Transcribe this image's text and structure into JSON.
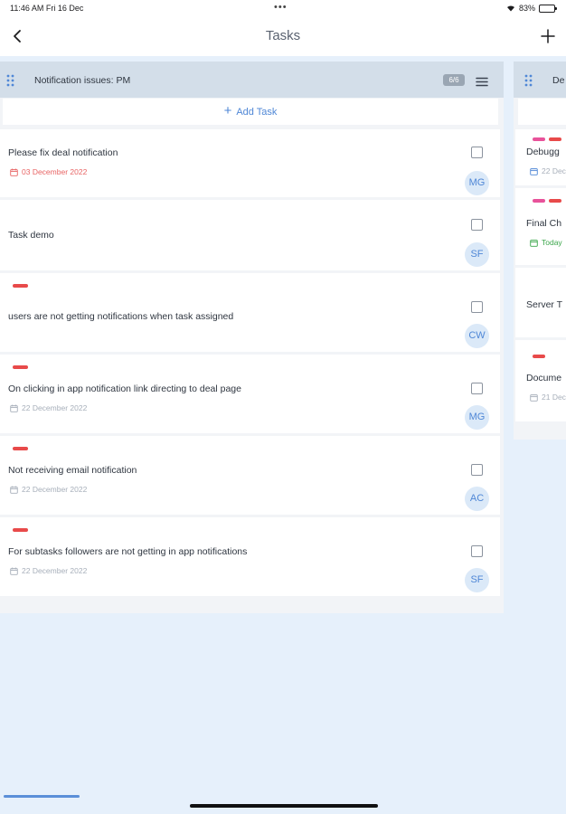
{
  "status_bar": {
    "time": "11:46 AM  Fri 16 Dec",
    "dots": "•••",
    "battery": "83%",
    "battery_level": 0.83
  },
  "nav": {
    "title": "Tasks",
    "back_icon": "chevron-left-icon",
    "add_icon": "plus-icon"
  },
  "column": {
    "title": "Notification issues: PM",
    "count": "6/6",
    "add_task_label": "Add Task",
    "cards": [
      {
        "title": "Please fix deal notification",
        "date": "03 December 2022",
        "date_style": "overdue",
        "avatar": "MG",
        "tag": false
      },
      {
        "title": "Task demo",
        "date": "",
        "avatar": "SF",
        "tag": false
      },
      {
        "title": "users are not getting notifications when task assigned",
        "date": "",
        "avatar": "CW",
        "tag": true
      },
      {
        "title": "On clicking in app notification link directing to deal page",
        "date": "22 December 2022",
        "avatar": "MG",
        "tag": true
      },
      {
        "title": "Not receiving email notification",
        "date": "22 December 2022",
        "avatar": "AC",
        "tag": true
      },
      {
        "title": "For subtasks followers are not getting in app notifications",
        "date": "22 December 2022",
        "avatar": "SF",
        "tag": true
      }
    ]
  },
  "column2": {
    "title": "De",
    "cards": [
      {
        "title": "Debugg",
        "date": "22 Dec"
      },
      {
        "title": "Final Ch",
        "date": "Today"
      },
      {
        "title": "Server T",
        "date": ""
      },
      {
        "title": "Docume",
        "date": "21 Dec"
      }
    ]
  },
  "colors": {
    "accent": "#4f87d6",
    "tag_red": "#e84a4a",
    "tag_pink": "#e8529a",
    "header_bg": "#d3dee9",
    "background": "#e6f0fb"
  }
}
